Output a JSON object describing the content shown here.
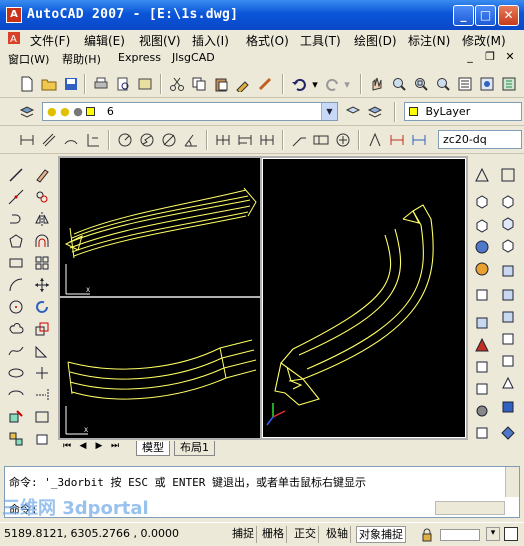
{
  "window": {
    "title": "AutoCAD 2007 - [E:\\1s.dwg]",
    "app_icon": "A"
  },
  "menu": {
    "row1": [
      "文件(F)",
      "编辑(E)",
      "视图(V)",
      "插入(I)",
      "格式(O)",
      "工具(T)",
      "绘图(D)",
      "标注(N)",
      "修改(M)"
    ],
    "row2": [
      "窗口(W)",
      "帮助(H)",
      "Express",
      "JlsgCAD"
    ]
  },
  "layer_toolbar": {
    "layer_value": "6",
    "color_value": "ByLayer"
  },
  "dim_toolbar": {
    "dimstyle_value": "zc20-dq"
  },
  "layout_tabs": {
    "model": "模型",
    "layout1": "布局1"
  },
  "command": {
    "line1": "命令: '_3dorbit 按 ESC 或 ENTER 键退出，或者单击鼠标右键显示",
    "prompt": "命令:"
  },
  "status": {
    "coords": "5189.8121, 6305.2766 , 0.0000",
    "buttons": [
      "捕捉",
      "栅格",
      "正交",
      "极轴",
      "对象捕捉"
    ]
  },
  "watermark": "三维网 3dportal",
  "colors": {
    "accent": "#0a55d8",
    "model": "#ffff66",
    "viewport_bg": "#000000"
  }
}
